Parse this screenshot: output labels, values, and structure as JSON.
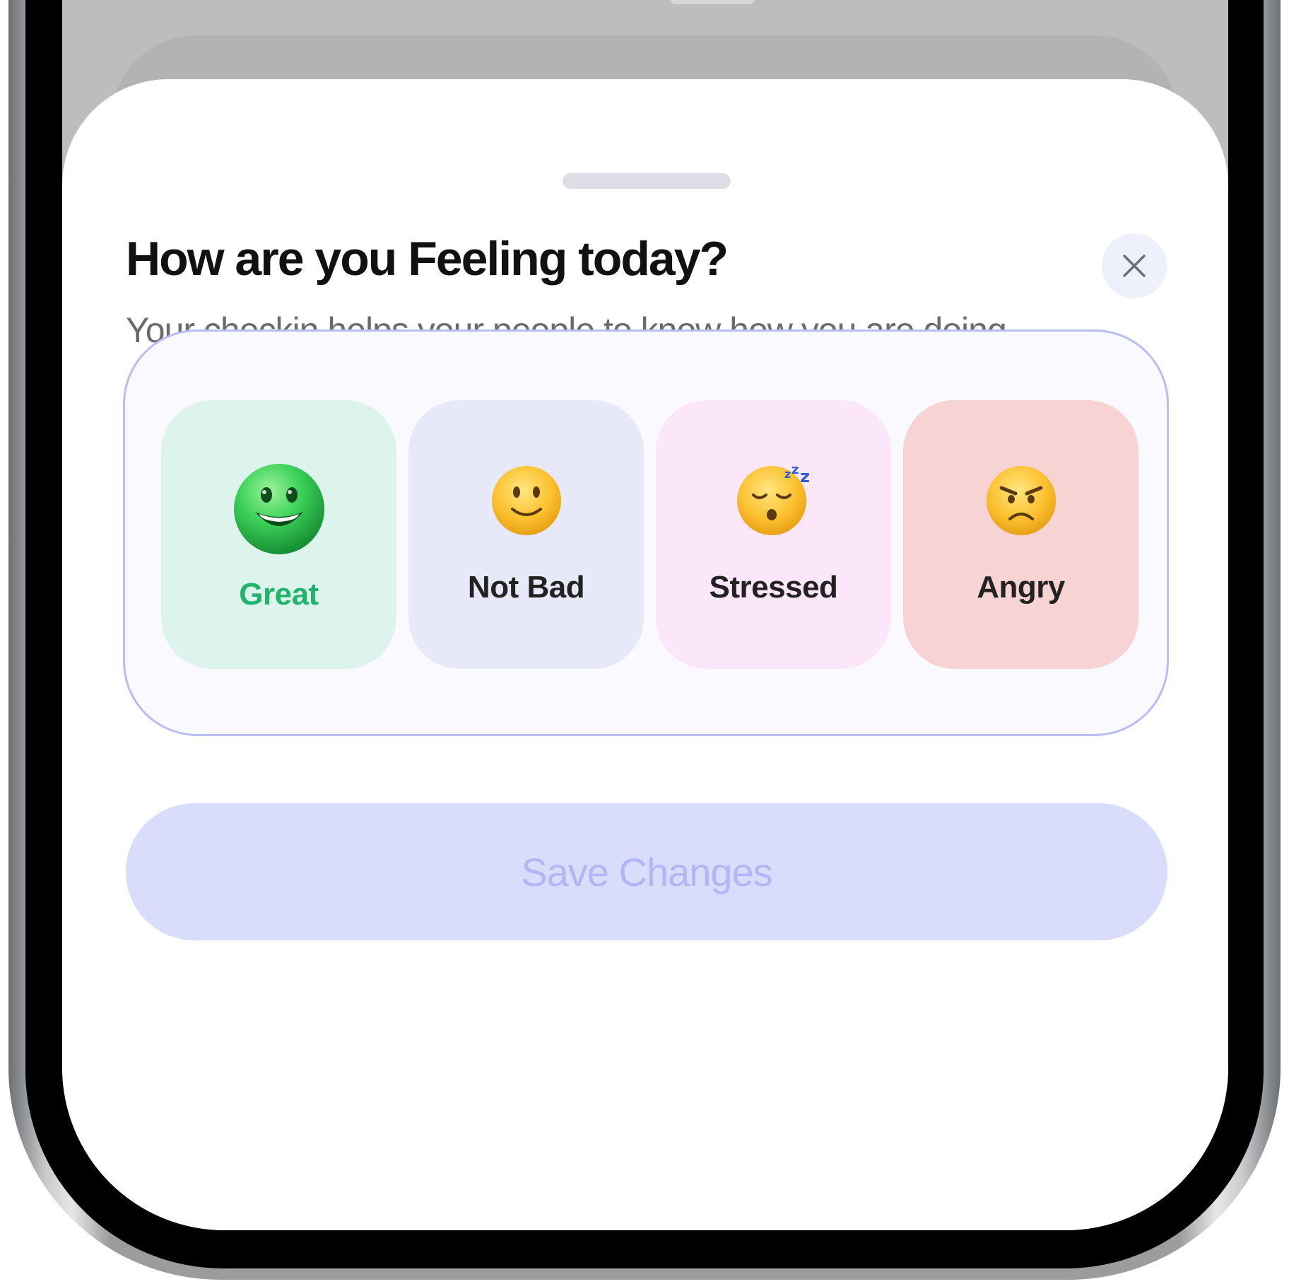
{
  "sheet": {
    "title": "How are you Feeling today?",
    "subtitle": "Your checkin helps your people to know how you are doing",
    "close_icon": "close-icon"
  },
  "moods": [
    {
      "label": "Great",
      "emoji": "grinning-face-green",
      "selected": true,
      "background": "#dcf4ec",
      "label_color": "#1fb36b"
    },
    {
      "label": "Not Bad",
      "emoji": "slightly-smiling-face",
      "selected": false,
      "background": "#e8e9f8",
      "label_color": "#222222"
    },
    {
      "label": "Stressed",
      "emoji": "sleeping-face",
      "selected": false,
      "background": "#fce6fa",
      "label_color": "#222222"
    },
    {
      "label": "Angry",
      "emoji": "angry-face",
      "selected": false,
      "background": "#f7d3d3",
      "label_color": "#222222"
    }
  ],
  "save_button": {
    "label": "Save Changes",
    "enabled": false
  },
  "colors": {
    "accent": "#b9bdf3",
    "button_bg": "#dadcfb",
    "button_text": "#b2b6f4",
    "selected_text": "#1fb36b"
  }
}
